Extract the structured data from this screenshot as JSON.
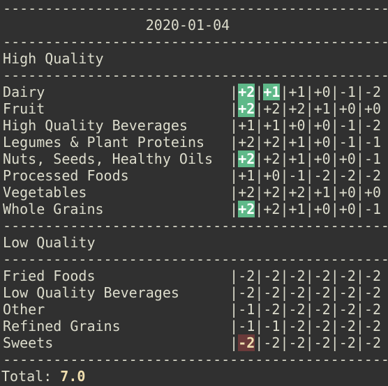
{
  "date": "2020-01-04",
  "sections": [
    {
      "title": "High Quality",
      "rows": [
        {
          "name": "Dairy",
          "scores": [
            "+2",
            "+1",
            "+1",
            "+0",
            "-1",
            "-2"
          ],
          "highlight": [
            0,
            1
          ]
        },
        {
          "name": "Fruit",
          "scores": [
            "+2",
            "+2",
            "+2",
            "+1",
            "+0",
            "+0"
          ],
          "highlight": [
            0
          ]
        },
        {
          "name": "High Quality Beverages",
          "scores": [
            "+1",
            "+1",
            "+0",
            "+0",
            "-1",
            "-2"
          ],
          "highlight": []
        },
        {
          "name": "Legumes & Plant Proteins",
          "scores": [
            "+2",
            "+2",
            "+1",
            "+0",
            "-1",
            "-1"
          ],
          "highlight": []
        },
        {
          "name": "Nuts, Seeds, Healthy Oils",
          "scores": [
            "+2",
            "+2",
            "+1",
            "+0",
            "+0",
            "-1"
          ],
          "highlight": [
            0
          ]
        },
        {
          "name": "Processed Foods",
          "scores": [
            "+1",
            "+0",
            "-1",
            "-2",
            "-2",
            "-2"
          ],
          "highlight": []
        },
        {
          "name": "Vegetables",
          "scores": [
            "+2",
            "+2",
            "+2",
            "+1",
            "+0",
            "+0"
          ],
          "highlight": []
        },
        {
          "name": "Whole Grains",
          "scores": [
            "+2",
            "+2",
            "+1",
            "+0",
            "+0",
            "-1"
          ],
          "highlight": [
            0
          ]
        }
      ]
    },
    {
      "title": "Low Quality",
      "rows": [
        {
          "name": "Fried Foods",
          "scores": [
            "-2",
            "-2",
            "-2",
            "-2",
            "-2",
            "-2"
          ],
          "highlight": []
        },
        {
          "name": "Low Quality Beverages",
          "scores": [
            "-2",
            "-2",
            "-2",
            "-2",
            "-2",
            "-2"
          ],
          "highlight": []
        },
        {
          "name": "Other",
          "scores": [
            "-1",
            "-2",
            "-2",
            "-2",
            "-2",
            "-2"
          ],
          "highlight": []
        },
        {
          "name": "Refined Grains",
          "scores": [
            "-1",
            "-1",
            "-2",
            "-2",
            "-2",
            "-2"
          ],
          "highlight": []
        },
        {
          "name": "Sweets",
          "scores": [
            "-2",
            "-2",
            "-2",
            "-2",
            "-2",
            "-2"
          ],
          "highlight_red": [
            0
          ]
        }
      ]
    }
  ],
  "total": {
    "label": "Total:",
    "value": "7.0"
  },
  "colors": {
    "background": "#303030",
    "text": "#dcdccc",
    "positive_highlight": "#5fb989",
    "negative_highlight": "#6b3a3a",
    "total_value": "#f0dfaf"
  }
}
